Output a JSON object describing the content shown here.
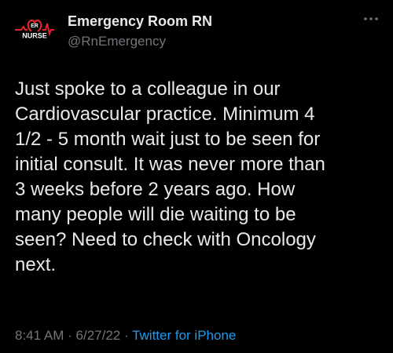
{
  "account": {
    "display_name": "Emergency Room RN",
    "handle": "@RnEmergency",
    "avatar_icon": "er-nurse-heartbeat-logo",
    "avatar_logo_text": {
      "top": "ER",
      "bottom": "NURSE"
    }
  },
  "more_icon": "more-dots-icon",
  "tweet": {
    "lines": [
      "Just spoke to a colleague in our",
      "Cardiovascular practice. Minimum 4",
      "1/2 - 5 month wait just to be seen for",
      "initial consult. It was never more than",
      "3 weeks before 2 years ago. How",
      "many people will die waiting to be",
      "seen? Need to check with Oncology",
      "next."
    ]
  },
  "meta": {
    "time": "8:41 AM",
    "separator1": "·",
    "date": "6/27/22",
    "separator2": "·",
    "source": "Twitter for iPhone"
  },
  "colors": {
    "background": "#000000",
    "primary_text": "#e7e9ea",
    "secondary_text": "#71767b",
    "link": "#1d9bf0",
    "logo_red": "#e0262f"
  }
}
